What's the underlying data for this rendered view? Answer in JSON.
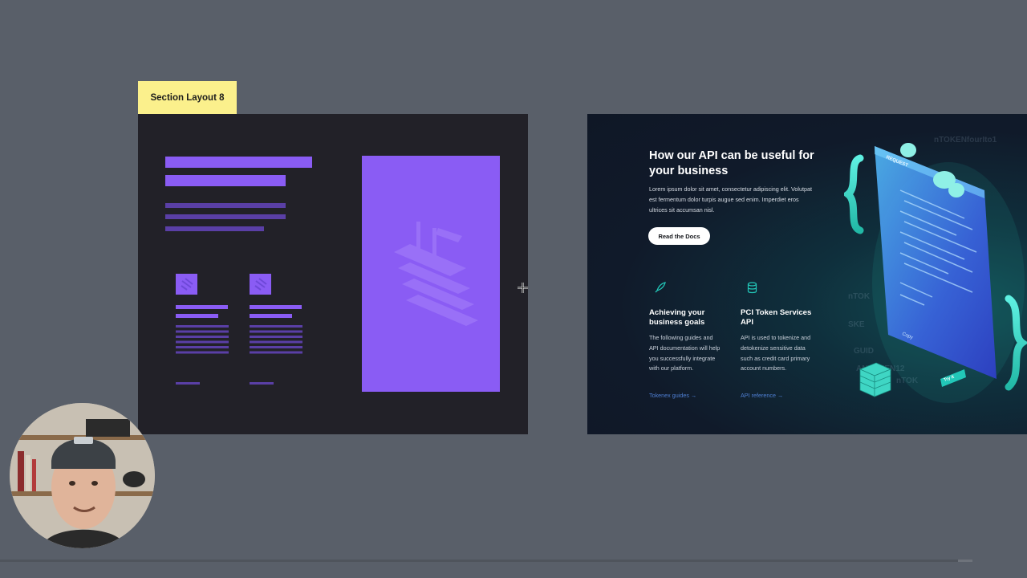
{
  "section_label": "Section Layout 8",
  "design": {
    "title": "How our API can be useful for your business",
    "body": "Lorem ipsum dolor sit amet, consectetur adipiscing elit. Volutpat est fermentum dolor turpis augue sed enim. Imperdiet eros ultrices sit accumsan nisl.",
    "button_label": "Read the Docs",
    "features": [
      {
        "icon": "rocket-icon",
        "title": "Achieving your business goals",
        "body": "The following guides and API documentation will help you successfully integrate with our platform.",
        "link": "Tokenex guides →"
      },
      {
        "icon": "database-icon",
        "title": "PCI Token Services API",
        "body": "API is used to tokenize and detokenize sensitive data such as credit card primary account numbers.",
        "link": "API reference →"
      }
    ],
    "illustration": {
      "header": "REQUEST",
      "watermark": "nTOKENfourIto1",
      "side_words": [
        "nTOK",
        "SKE",
        "GUID",
        "ANTOKEN12",
        "nTOK"
      ],
      "button": "Try it",
      "copy_label": "Copy"
    }
  },
  "colors": {
    "canvas": "#595f69",
    "label_bg": "#fbf08c",
    "wireframe_bg": "#222128",
    "wireframe_accent": "#8a5cf4",
    "design_bg": "#0f1726",
    "link_blue": "#4f7fd3",
    "teal": "#22c7b8"
  },
  "video": {
    "progress": 0.985
  }
}
